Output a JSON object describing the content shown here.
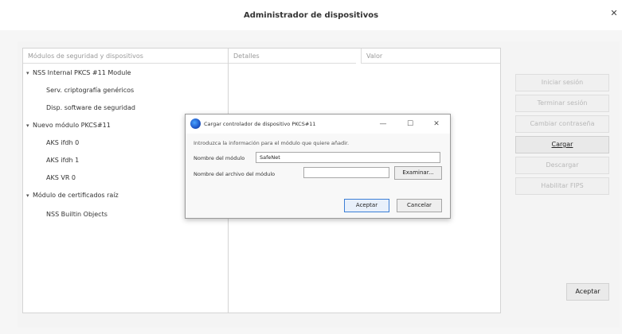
{
  "window": {
    "title": "Administrador de dispositivos",
    "close_icon": "close-icon"
  },
  "tree": {
    "column_header": "Módulos de seguridad y dispositivos",
    "items": [
      {
        "label": "NSS Internal PKCS #11 Module",
        "expandable": true
      },
      {
        "label": "Serv. criptografía genéricos",
        "expandable": false
      },
      {
        "label": "Disp. software de seguridad",
        "expandable": false
      },
      {
        "label": "Nuevo módulo PKCS#11",
        "expandable": true
      },
      {
        "label": "AKS ifdh 0",
        "expandable": false
      },
      {
        "label": "AKS ifdh 1",
        "expandable": false
      },
      {
        "label": "AKS VR 0",
        "expandable": false
      },
      {
        "label": "Módulo de certificados raíz",
        "expandable": true
      },
      {
        "label": "NSS Builtin Objects",
        "expandable": false
      }
    ],
    "toggle_glyph": "▾"
  },
  "details": {
    "header_details": "Detalles",
    "header_value": "Valor"
  },
  "side_buttons": {
    "login": "Iniciar sesión",
    "logout": "Terminar sesión",
    "change_password": "Cambiar contraseña",
    "load": "Cargar",
    "unload": "Descargar",
    "enable_fips": "Habilitar FIPS"
  },
  "footer": {
    "ok_label": "Aceptar"
  },
  "dialog": {
    "title": "Cargar controlador de dispositivo PKCS#11",
    "intro": "Introduzca la información para el módulo que quiere añadir.",
    "module_name_label": "Nombre del módulo",
    "module_name_value": "SafeNet",
    "module_file_label": "Nombre del archivo del módulo",
    "module_file_value": "",
    "browse_label": "Examinar...",
    "accept_label": "Aceptar",
    "cancel_label": "Cancelar",
    "minimize_glyph": "—",
    "maximize_glyph": "☐",
    "close_glyph": "✕",
    "accent_color": "#3c7fd6"
  }
}
